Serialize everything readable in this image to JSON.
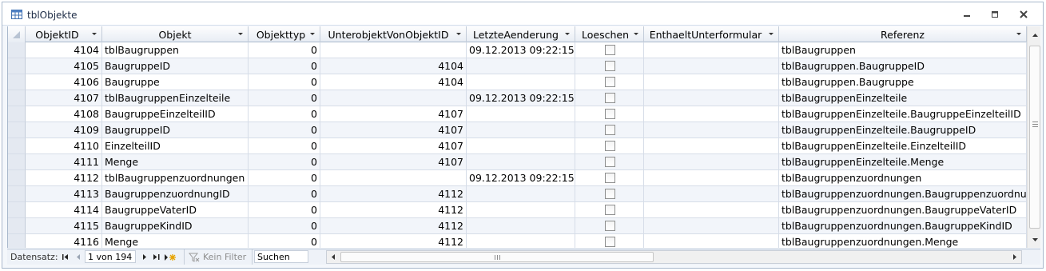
{
  "window": {
    "title": "tblObjekte",
    "icon": "table-icon"
  },
  "columns": [
    {
      "key": "ObjektID",
      "label": "ObjektID"
    },
    {
      "key": "Objekt",
      "label": "Objekt"
    },
    {
      "key": "Objekttyp",
      "label": "Objekttyp"
    },
    {
      "key": "UnterobjektVonObjektID",
      "label": "UnterobjektVonObjektID"
    },
    {
      "key": "LetzteAenderung",
      "label": "LetzteAenderung"
    },
    {
      "key": "Loeschen",
      "label": "Loeschen"
    },
    {
      "key": "EnthaeltUnterformular",
      "label": "EnthaeltUnterformular"
    },
    {
      "key": "Referenz",
      "label": "Referenz"
    }
  ],
  "rows": [
    {
      "id": "4104",
      "objekt": "tblBaugruppen",
      "typ": "0",
      "unter": "",
      "datum": "09.12.2013 09:22:15",
      "loeschen": false,
      "enth": "",
      "ref": "tblBaugruppen"
    },
    {
      "id": "4105",
      "objekt": "BaugruppeID",
      "typ": "0",
      "unter": "4104",
      "datum": "",
      "loeschen": false,
      "enth": "",
      "ref": "tblBaugruppen.BaugruppeID"
    },
    {
      "id": "4106",
      "objekt": "Baugruppe",
      "typ": "0",
      "unter": "4104",
      "datum": "",
      "loeschen": false,
      "enth": "",
      "ref": "tblBaugruppen.Baugruppe"
    },
    {
      "id": "4107",
      "objekt": "tblBaugruppenEinzelteile",
      "typ": "0",
      "unter": "",
      "datum": "09.12.2013 09:22:15",
      "loeschen": false,
      "enth": "",
      "ref": "tblBaugruppenEinzelteile"
    },
    {
      "id": "4108",
      "objekt": "BaugruppeEinzelteilID",
      "typ": "0",
      "unter": "4107",
      "datum": "",
      "loeschen": false,
      "enth": "",
      "ref": "tblBaugruppenEinzelteile.BaugruppeEinzelteilID"
    },
    {
      "id": "4109",
      "objekt": "BaugruppeID",
      "typ": "0",
      "unter": "4107",
      "datum": "",
      "loeschen": false,
      "enth": "",
      "ref": "tblBaugruppenEinzelteile.BaugruppeID"
    },
    {
      "id": "4110",
      "objekt": "EinzelteilID",
      "typ": "0",
      "unter": "4107",
      "datum": "",
      "loeschen": false,
      "enth": "",
      "ref": "tblBaugruppenEinzelteile.EinzelteilID"
    },
    {
      "id": "4111",
      "objekt": "Menge",
      "typ": "0",
      "unter": "4107",
      "datum": "",
      "loeschen": false,
      "enth": "",
      "ref": "tblBaugruppenEinzelteile.Menge"
    },
    {
      "id": "4112",
      "objekt": "tblBaugruppenzuordnungen",
      "typ": "0",
      "unter": "",
      "datum": "09.12.2013 09:22:15",
      "loeschen": false,
      "enth": "",
      "ref": "tblBaugruppenzuordnungen"
    },
    {
      "id": "4113",
      "objekt": "BaugruppenzuordnungID",
      "typ": "0",
      "unter": "4112",
      "datum": "",
      "loeschen": false,
      "enth": "",
      "ref": "tblBaugruppenzuordnungen.Baugruppenzuordnu"
    },
    {
      "id": "4114",
      "objekt": "BaugruppeVaterID",
      "typ": "0",
      "unter": "4112",
      "datum": "",
      "loeschen": false,
      "enth": "",
      "ref": "tblBaugruppenzuordnungen.BaugruppeVaterID"
    },
    {
      "id": "4115",
      "objekt": "BaugruppeKindID",
      "typ": "0",
      "unter": "4112",
      "datum": "",
      "loeschen": false,
      "enth": "",
      "ref": "tblBaugruppenzuordnungen.BaugruppeKindID"
    },
    {
      "id": "4116",
      "objekt": "Menge",
      "typ": "0",
      "unter": "4112",
      "datum": "",
      "loeschen": false,
      "enth": "",
      "ref": "tblBaugruppenzuordnungen.Menge"
    }
  ],
  "navigation": {
    "label": "Datensatz:",
    "position": "1 von 194",
    "filter_label": "Kein Filter",
    "search_placeholder": "Suchen"
  },
  "colors": {
    "border": "#a9b8cc",
    "alt_row": "#f2f5fa",
    "selector": "#e4e9f1"
  }
}
